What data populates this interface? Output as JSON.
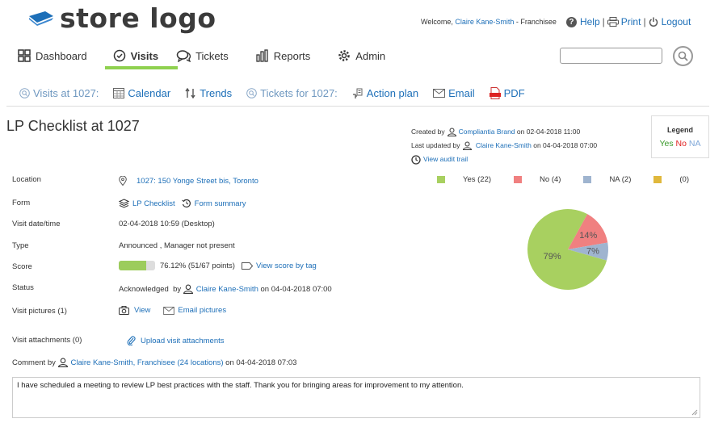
{
  "logo": {
    "text": "store logo",
    "accent": "#1d6fb8"
  },
  "userbar": {
    "welcome": "Welcome,",
    "user": "Claire Kane-Smith",
    "role": "- Franchisee",
    "help": "Help",
    "print": "Print",
    "logout": "Logout"
  },
  "nav": {
    "dashboard": "Dashboard",
    "visits": "Visits",
    "tickets": "Tickets",
    "reports": "Reports",
    "admin": "Admin"
  },
  "subnav": {
    "visits_at": "Visits at 1027:",
    "calendar": "Calendar",
    "trends": "Trends",
    "tickets_for": "Tickets for 1027:",
    "action_plan": "Action plan",
    "email": "Email",
    "pdf": "PDF"
  },
  "page": {
    "title": "LP Checklist at 1027"
  },
  "meta": {
    "created_by_label": "Created by",
    "created_by": "Compliantia Brand",
    "created_on": "on 02-04-2018 11:00",
    "updated_label": "Last updated by",
    "updated_by": "Claire Kane-Smith",
    "updated_on": "on 04-04-2018 07:00",
    "audit": "View audit trail"
  },
  "legend": {
    "title": "Legend",
    "yes": "Yes",
    "no": "No",
    "na": "NA"
  },
  "details": {
    "location_label": "Location",
    "location": "1027: 150 Yonge Street bis, Toronto",
    "form_label": "Form",
    "form": "LP Checklist",
    "form_summary": "Form summary",
    "datetime_label": "Visit date/time",
    "datetime": "02-04-2018 10:59 (Desktop)",
    "type_label": "Type",
    "type": "Announced , Manager not present",
    "score_label": "Score",
    "score": "76.12% (51/67 points)",
    "score_value": 0.7612,
    "score_by_tag": "View score by tag",
    "status_label": "Status",
    "status": "Acknowledged",
    "status_by": "by",
    "status_user": "Claire Kane-Smith",
    "status_on": "on 04-04-2018 07:00",
    "pictures_label": "Visit pictures (1)",
    "view": "View",
    "email_pictures": "Email pictures",
    "attachments_label": "Visit attachments (0)",
    "upload": "Upload visit attachments",
    "comment_by": "Comment by",
    "comment_user": "Claire Kane-Smith, Franchisee (24 locations)",
    "comment_on": "on 04-04-2018 07:03",
    "comment": "I have scheduled a meeting to review LP best practices with the staff. Thank you for bringing areas for improvement to my attention."
  },
  "chart_data": {
    "type": "pie",
    "series": [
      {
        "name": "Yes",
        "legend": "Yes (22)",
        "count": 22,
        "pct_label": "79%",
        "color": "#a8d060"
      },
      {
        "name": "No",
        "legend": "No (4)",
        "count": 4,
        "pct_label": "14%",
        "color": "#f08080"
      },
      {
        "name": "NA",
        "legend": "NA (2)",
        "count": 2,
        "pct_label": "7%",
        "color": "#9fb4cf"
      },
      {
        "name": "",
        "legend": "(0)",
        "count": 0,
        "pct_label": "",
        "color": "#e0b83c"
      }
    ]
  },
  "colors": {
    "link": "#1d6fb8",
    "active": "#8fd14f",
    "yes": "#3a9a2a",
    "no": "#e02020",
    "na": "#7fa7d8"
  }
}
